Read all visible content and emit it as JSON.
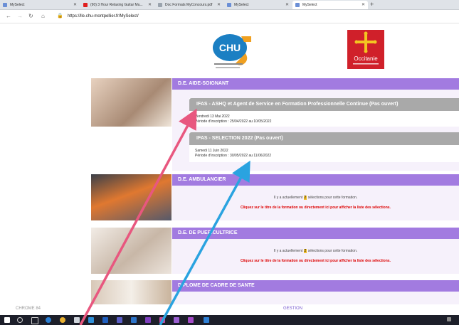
{
  "browser": {
    "tabs": [
      {
        "label": "MySelect",
        "active": false
      },
      {
        "label": "(90) 3 Hour Relaxing Guitar Mu...",
        "active": false
      },
      {
        "label": "Doc Formats MyConcours.pdf",
        "active": false
      },
      {
        "label": "MySelect",
        "active": false
      },
      {
        "label": "MySelect",
        "active": true
      }
    ],
    "new_tab": "+",
    "url": "https://lle.chu-montpellier.fr/MySelect/"
  },
  "logos": {
    "chu": "CHU",
    "region": "Occitanie"
  },
  "sections": [
    {
      "title": "D.E. AIDE-SOIGNANT",
      "sessions": [
        {
          "title": "IFAS - ASHQ et Agent de Service en Formation Professionnelle Continue (Pas ouvert)",
          "date": "Vendredi 13 Mai 2022",
          "period": "Période d'inscription : 25/04/2022 au 10/05/2022"
        },
        {
          "title": "IFAS - SELECTION 2022 (Pas ouvert)",
          "date": "Samedi 11 Juin 2022",
          "period": "Période d'inscription : 30/05/2022 au 11/06/2022"
        }
      ]
    },
    {
      "title": "D.E. AMBULANCIER",
      "info_pre": "Il y a actuellement",
      "info_count": "2",
      "info_post": "sélections pour cette formation.",
      "cta": "Cliquez sur le titre de la formation ou directement ici pour afficher la liste des sélections."
    },
    {
      "title": "D.E. DE PUERICULTRICE",
      "info_pre": "Il y a actuellement",
      "info_count": "2",
      "info_post": "sélections pour cette formation.",
      "cta": "Cliquez sur le titre de la formation ou directement ici pour afficher la liste des sélections."
    },
    {
      "title": "DIPLOME DE CADRE DE SANTE"
    }
  ],
  "footer": {
    "left": "CHROME 84",
    "center": "GESTION"
  },
  "colors": {
    "header_purple": "#a27be0",
    "session_gray": "#a9a9a9",
    "arrow_pink": "#e8577f",
    "arrow_blue": "#2aa3e0"
  }
}
